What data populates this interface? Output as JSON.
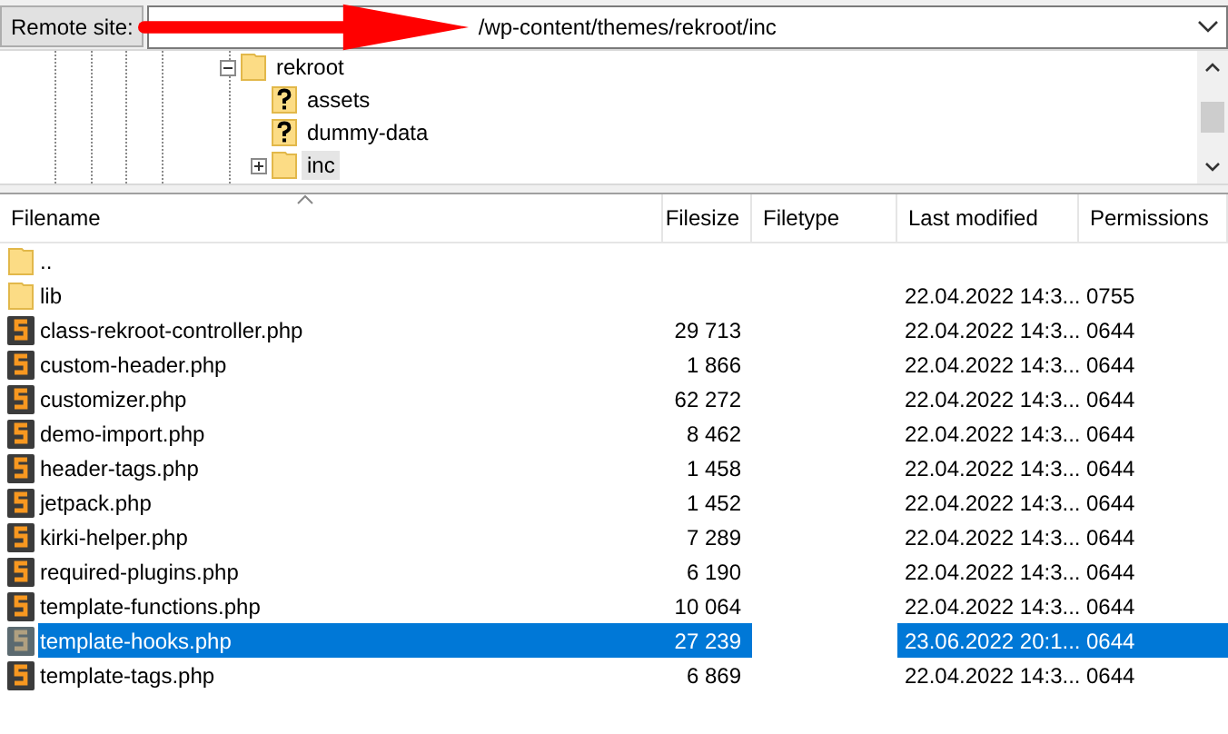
{
  "remote_site": {
    "label": "Remote site:",
    "value": "/wp-content/themes/rekroot/inc"
  },
  "tree": [
    {
      "label": "rekroot",
      "kind": "folder",
      "expanded": true,
      "selected": false,
      "children": [
        {
          "label": "assets",
          "kind": "unknown",
          "selected": false
        },
        {
          "label": "dummy-data",
          "kind": "unknown",
          "selected": false
        },
        {
          "label": "inc",
          "kind": "folder",
          "expanded": false,
          "selected": true
        }
      ]
    }
  ],
  "table": {
    "columns": [
      "Filename",
      "Filesize",
      "Filetype",
      "Last modified",
      "Permissions"
    ],
    "rows": [
      {
        "kind": "folder",
        "name": "..",
        "selected": false
      },
      {
        "kind": "folder",
        "name": "lib",
        "modified": "22.04.2022 14:3...",
        "permissions": "0755",
        "selected": false
      },
      {
        "kind": "php",
        "name": "class-rekroot-controller.php",
        "size": "29 713",
        "modified": "22.04.2022 14:3...",
        "permissions": "0644",
        "selected": false
      },
      {
        "kind": "php",
        "name": "custom-header.php",
        "size": "1 866",
        "modified": "22.04.2022 14:3...",
        "permissions": "0644",
        "selected": false
      },
      {
        "kind": "php",
        "name": "customizer.php",
        "size": "62 272",
        "modified": "22.04.2022 14:3...",
        "permissions": "0644",
        "selected": false
      },
      {
        "kind": "php",
        "name": "demo-import.php",
        "size": "8 462",
        "modified": "22.04.2022 14:3...",
        "permissions": "0644",
        "selected": false
      },
      {
        "kind": "php",
        "name": "header-tags.php",
        "size": "1 458",
        "modified": "22.04.2022 14:3...",
        "permissions": "0644",
        "selected": false
      },
      {
        "kind": "php",
        "name": "jetpack.php",
        "size": "1 452",
        "modified": "22.04.2022 14:3...",
        "permissions": "0644",
        "selected": false
      },
      {
        "kind": "php",
        "name": "kirki-helper.php",
        "size": "7 289",
        "modified": "22.04.2022 14:3...",
        "permissions": "0644",
        "selected": false
      },
      {
        "kind": "php",
        "name": "required-plugins.php",
        "size": "6 190",
        "modified": "22.04.2022 14:3...",
        "permissions": "0644",
        "selected": false
      },
      {
        "kind": "php",
        "name": "template-functions.php",
        "size": "10 064",
        "modified": "22.04.2022 14:3...",
        "permissions": "0644",
        "selected": false
      },
      {
        "kind": "php",
        "name": "template-hooks.php",
        "size": "27 239",
        "modified": "23.06.2022 20:1...",
        "permissions": "0644",
        "selected": true
      },
      {
        "kind": "php",
        "name": "template-tags.php",
        "size": "6 869",
        "modified": "22.04.2022 14:3...",
        "permissions": "0644",
        "selected": false
      }
    ]
  }
}
